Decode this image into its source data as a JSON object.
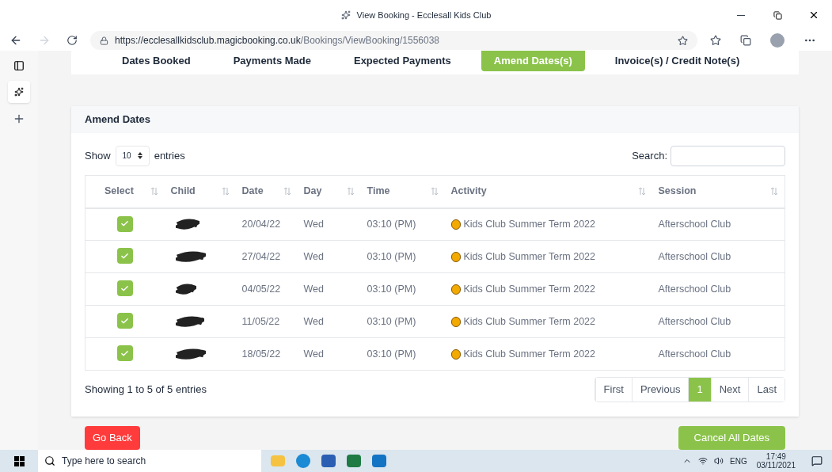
{
  "window": {
    "title": "View Booking - Ecclesall Kids Club"
  },
  "browser": {
    "url_host": "https://ecclesallkidsclub.magicbooking.co.uk",
    "url_path": "/Bookings/ViewBooking/1556038"
  },
  "tabs": [
    {
      "label": "Dates Booked",
      "selected": false
    },
    {
      "label": "Payments Made",
      "selected": false
    },
    {
      "label": "Expected Payments",
      "selected": false
    },
    {
      "label": "Amend Dates(s)",
      "selected": true
    },
    {
      "label": "Invoice(s) / Credit Note(s)",
      "selected": false
    }
  ],
  "panel": {
    "title": "Amend Dates",
    "show_label": "Show",
    "page_size": "10",
    "entries_label": "entries",
    "search_label": "Search:",
    "columns": [
      "Select",
      "Child",
      "Date",
      "Day",
      "Time",
      "Activity",
      "Session"
    ],
    "rows": [
      {
        "checked": true,
        "date": "20/04/22",
        "day": "Wed",
        "time": "03:10 (PM)",
        "activity": "Kids Club Summer Term 2022",
        "session": "Afterschool Club"
      },
      {
        "checked": true,
        "date": "27/04/22",
        "day": "Wed",
        "time": "03:10 (PM)",
        "activity": "Kids Club Summer Term 2022",
        "session": "Afterschool Club"
      },
      {
        "checked": true,
        "date": "04/05/22",
        "day": "Wed",
        "time": "03:10 (PM)",
        "activity": "Kids Club Summer Term 2022",
        "session": "Afterschool Club"
      },
      {
        "checked": true,
        "date": "11/05/22",
        "day": "Wed",
        "time": "03:10 (PM)",
        "activity": "Kids Club Summer Term 2022",
        "session": "Afterschool Club"
      },
      {
        "checked": true,
        "date": "18/05/22",
        "day": "Wed",
        "time": "03:10 (PM)",
        "activity": "Kids Club Summer Term 2022",
        "session": "Afterschool Club"
      }
    ],
    "info": "Showing 1 to 5 of 5 entries",
    "pagination": [
      {
        "label": "First",
        "selected": false
      },
      {
        "label": "Previous",
        "selected": false
      },
      {
        "label": "1",
        "selected": true
      },
      {
        "label": "Next",
        "selected": false
      },
      {
        "label": "Last",
        "selected": false
      }
    ],
    "go_back": "Go Back",
    "cancel_all": "Cancel All Dates"
  },
  "taskbar": {
    "search_placeholder": "Type here to search",
    "language": "ENG",
    "time": "17:49",
    "date": "03/11/2021"
  }
}
